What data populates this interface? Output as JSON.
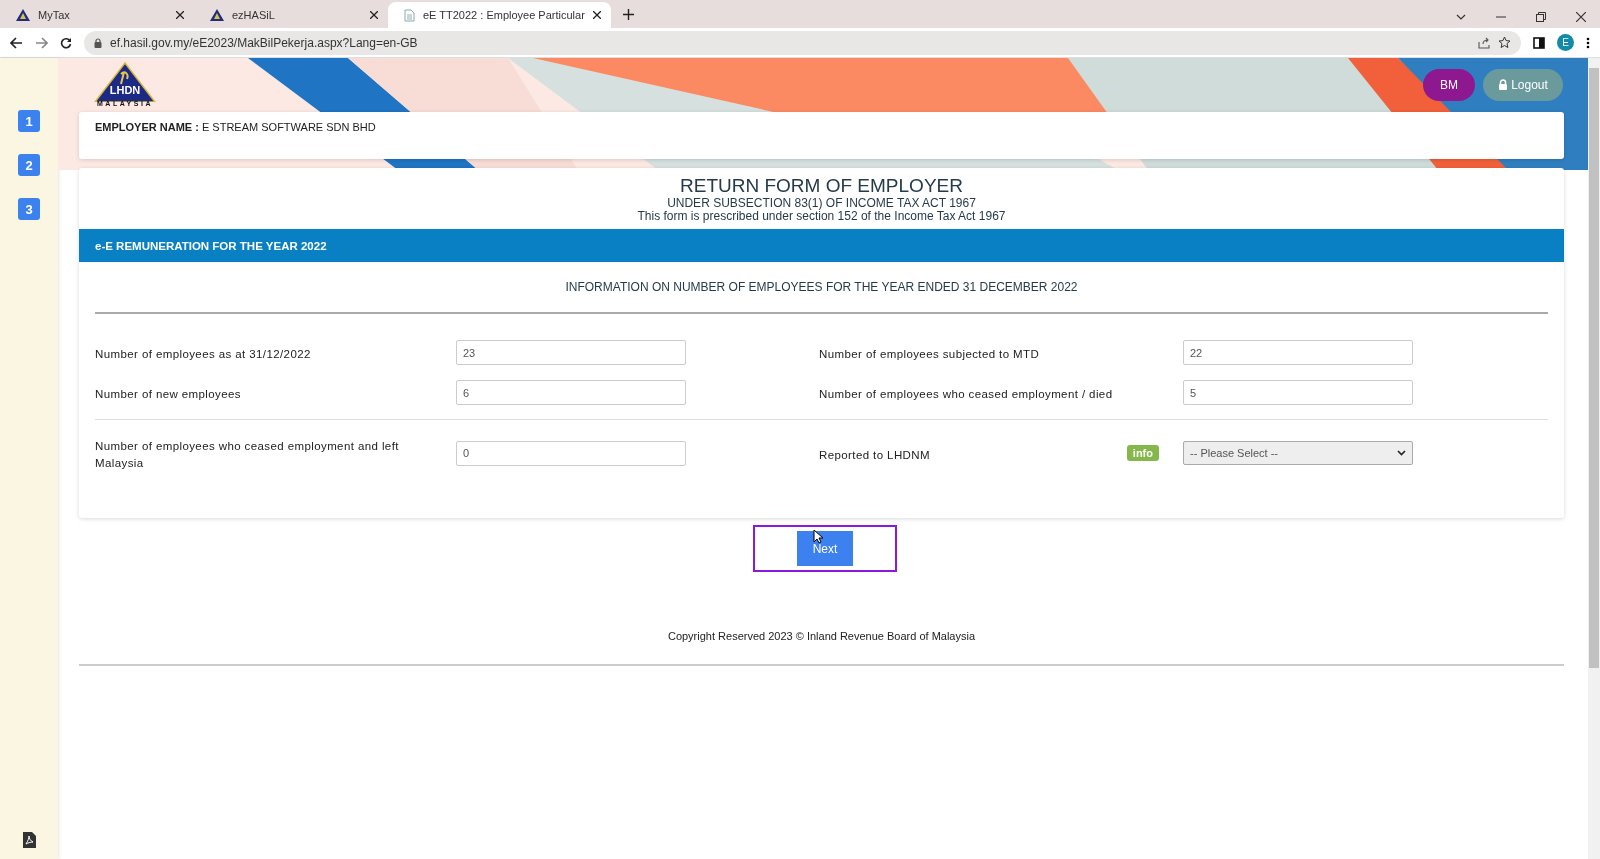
{
  "browser": {
    "tabs": [
      {
        "title": "MyTax",
        "selected": false
      },
      {
        "title": "ezHASiL",
        "selected": false
      },
      {
        "title": "eE TT2022 : Employee Particular",
        "selected": true
      }
    ],
    "url": "ef.hasil.gov.my/eE2023/MakBilPekerja.aspx?Lang=en-GB",
    "profile": "E"
  },
  "header": {
    "logo": {
      "title": "LHDN",
      "subtitle": "MALAYSIA"
    },
    "buttons": [
      {
        "label": "BM",
        "kind": "language"
      },
      {
        "label": "Logout",
        "kind": "logout"
      }
    ]
  },
  "steps": [
    {
      "label": "1"
    },
    {
      "label": "2"
    },
    {
      "label": "3"
    }
  ],
  "employer": {
    "label": "EMPLOYER NAME :",
    "value": "E STREAM SOFTWARE SDN BHD"
  },
  "form": {
    "title": "RETURN FORM OF EMPLOYER",
    "subtitle": "UNDER SUBSECTION 83(1) OF INCOME TAX ACT 1967",
    "note": "This form is prescribed under section 152 of the Income Tax Act 1967",
    "section": "e-E REMUNERATION FOR THE YEAR 2022",
    "heading": "INFORMATION ON NUMBER OF EMPLOYEES FOR THE YEAR ENDED 31 DECEMBER 2022",
    "rows": [
      {
        "divider": false,
        "fields": [
          {
            "label": "Number of employees as at 31/12/2022",
            "kind": "input",
            "value": "23"
          },
          {
            "label": "Number of employees subjected to MTD",
            "kind": "input",
            "value": "22"
          }
        ]
      },
      {
        "divider": false,
        "fields": [
          {
            "label": "Number of new employees",
            "kind": "input",
            "value": "6"
          },
          {
            "label": "Number of employees who ceased employment / died",
            "kind": "input",
            "value": "5"
          }
        ]
      },
      {
        "divider": true,
        "fields": [
          {
            "label": "Number of employees who ceased employment and left Malaysia",
            "kind": "input",
            "value": "0"
          },
          {
            "label": "Reported to LHDNM",
            "kind": "select",
            "value": "-- Please Select --",
            "badge": "info"
          }
        ]
      }
    ]
  },
  "next": {
    "label": "Next",
    "highlighted": true
  },
  "footer": "Copyright Reserved 2023 © Inland Revenue Board of Malaysia"
}
